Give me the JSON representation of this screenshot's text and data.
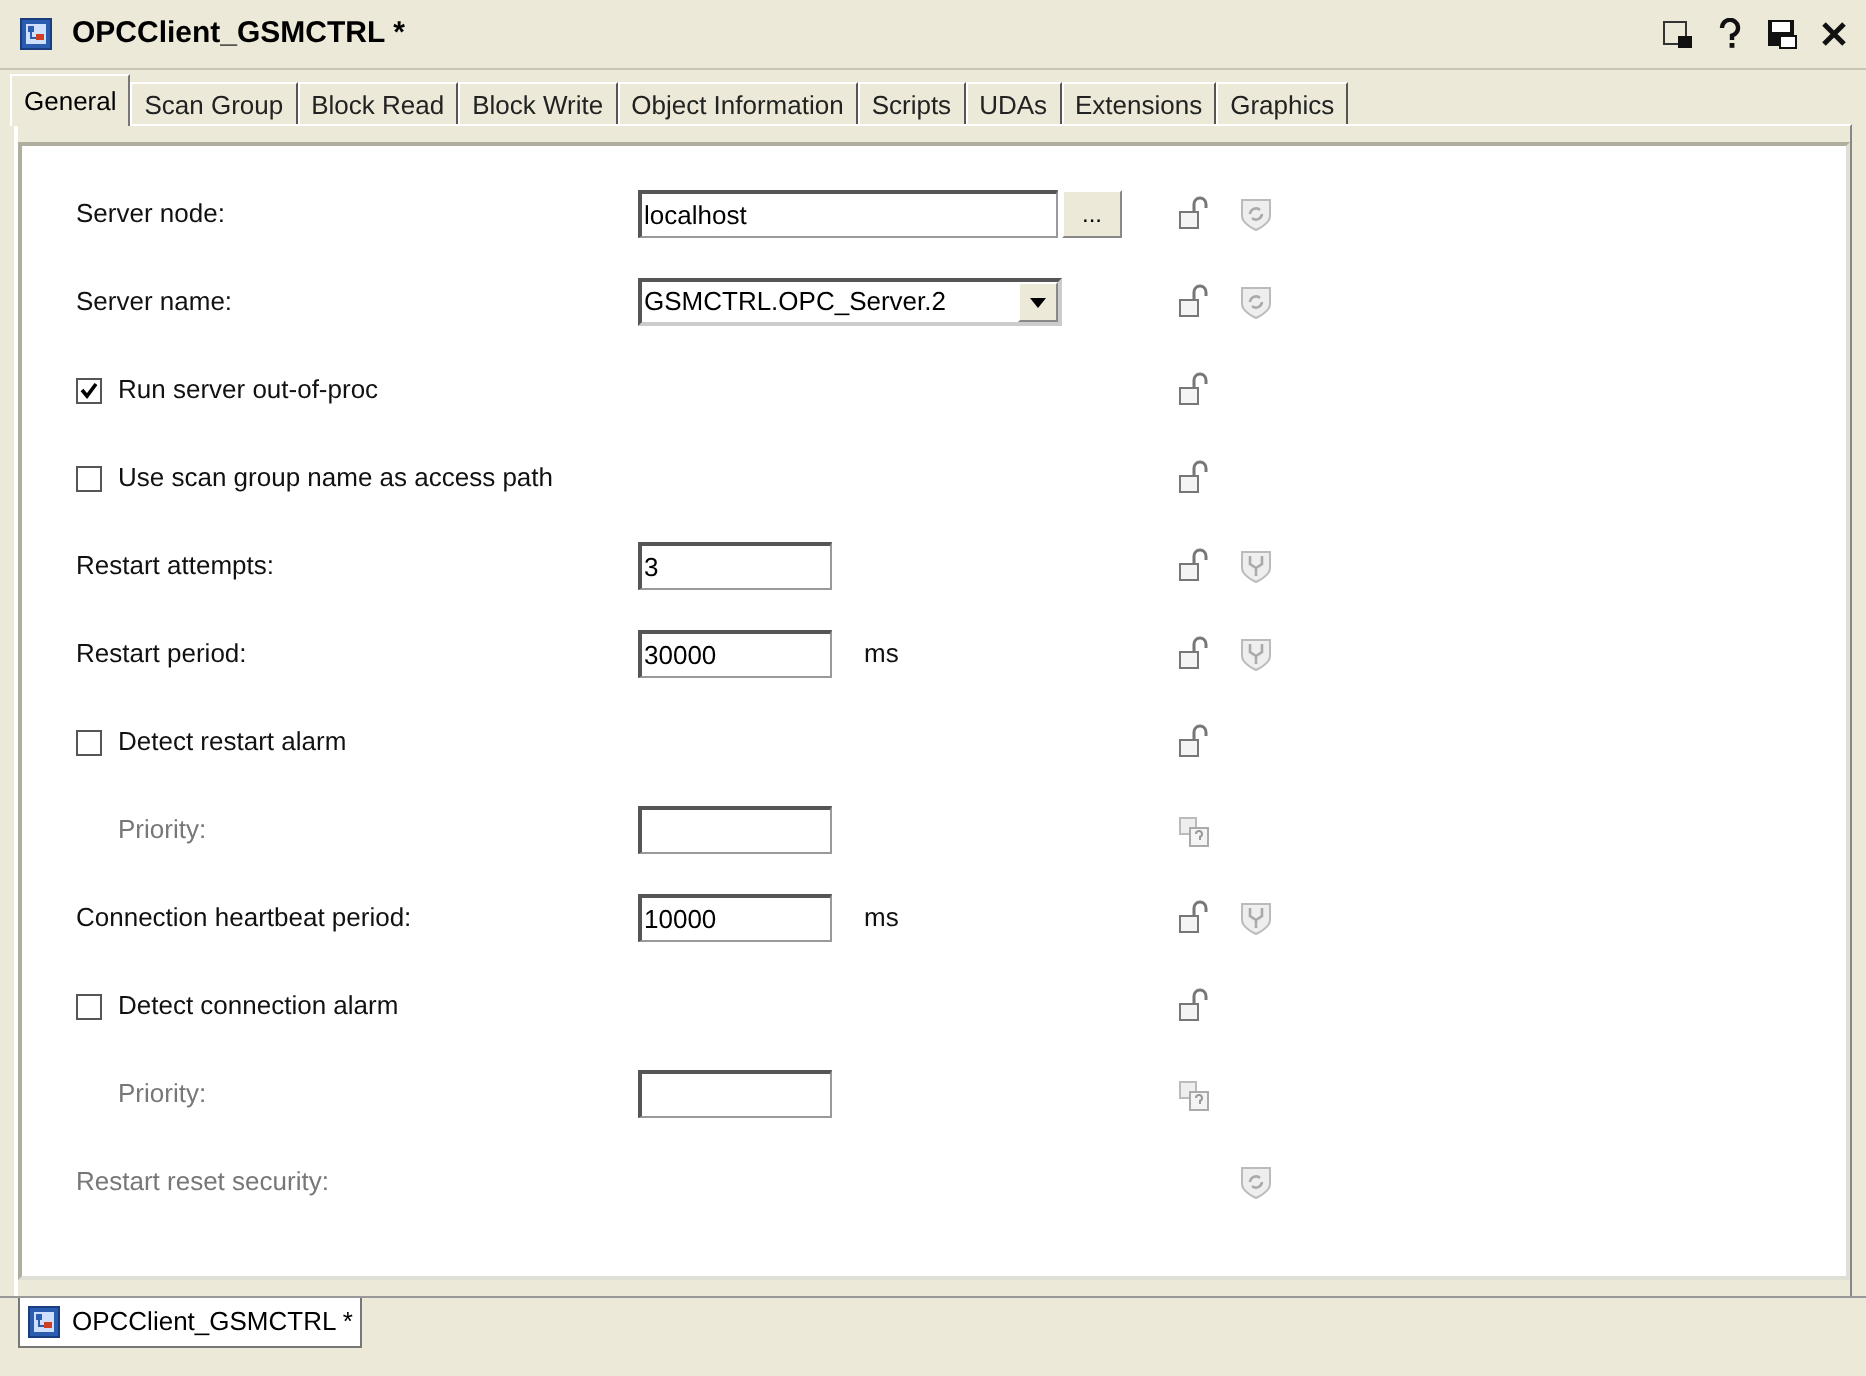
{
  "window": {
    "title": "OPCClient_GSMCTRL *"
  },
  "tabs": [
    {
      "label": "General",
      "selected": true
    },
    {
      "label": "Scan Group",
      "selected": false
    },
    {
      "label": "Block Read",
      "selected": false
    },
    {
      "label": "Block Write",
      "selected": false
    },
    {
      "label": "Object Information",
      "selected": false
    },
    {
      "label": "Scripts",
      "selected": false
    },
    {
      "label": "UDAs",
      "selected": false
    },
    {
      "label": "Extensions",
      "selected": false
    },
    {
      "label": "Graphics",
      "selected": false
    }
  ],
  "rows": [
    {
      "kind": "text",
      "label": "Server node:",
      "value": "localhost",
      "browse": "...",
      "lock": {
        "kind": "open"
      },
      "security": {
        "kind": "sync"
      }
    },
    {
      "kind": "dropdown",
      "label": "Server name:",
      "value": "GSMCTRL.OPC_Server.2",
      "lock": {
        "kind": "open"
      },
      "security": {
        "kind": "sync"
      }
    },
    {
      "kind": "checkbox",
      "label": "Run server out-of-proc",
      "checked": true,
      "lock": {
        "kind": "open"
      }
    },
    {
      "kind": "checkbox",
      "label": "Use scan group name as access path",
      "checked": false,
      "lock": {
        "kind": "open"
      }
    },
    {
      "kind": "number",
      "label": "Restart attempts:",
      "value": "3",
      "lock": {
        "kind": "open"
      },
      "security": {
        "kind": "fork"
      }
    },
    {
      "kind": "number",
      "label": "Restart period:",
      "value": "30000",
      "unit": "ms",
      "lock": {
        "kind": "open"
      },
      "security": {
        "kind": "fork"
      }
    },
    {
      "kind": "checkbox",
      "label": "Detect restart alarm",
      "checked": false,
      "lock": {
        "kind": "open"
      }
    },
    {
      "kind": "sub",
      "label": "Priority:",
      "disabled": true,
      "lock": {
        "kind": "unknown"
      }
    },
    {
      "kind": "number",
      "label": "Connection heartbeat period:",
      "value": "10000",
      "unit": "ms",
      "lock": {
        "kind": "open"
      },
      "security": {
        "kind": "fork"
      }
    },
    {
      "kind": "checkbox",
      "label": "Detect connection alarm",
      "checked": false,
      "lock": {
        "kind": "open"
      }
    },
    {
      "kind": "sub",
      "label": "Priority:",
      "disabled": true,
      "lock": {
        "kind": "unknown"
      }
    },
    {
      "kind": "label",
      "label": "Restart reset security:",
      "disabled": true,
      "security": {
        "kind": "sync"
      }
    }
  ],
  "document_tabs": [
    {
      "label": "OPCClient_GSMCTRL *",
      "selected": true
    }
  ]
}
